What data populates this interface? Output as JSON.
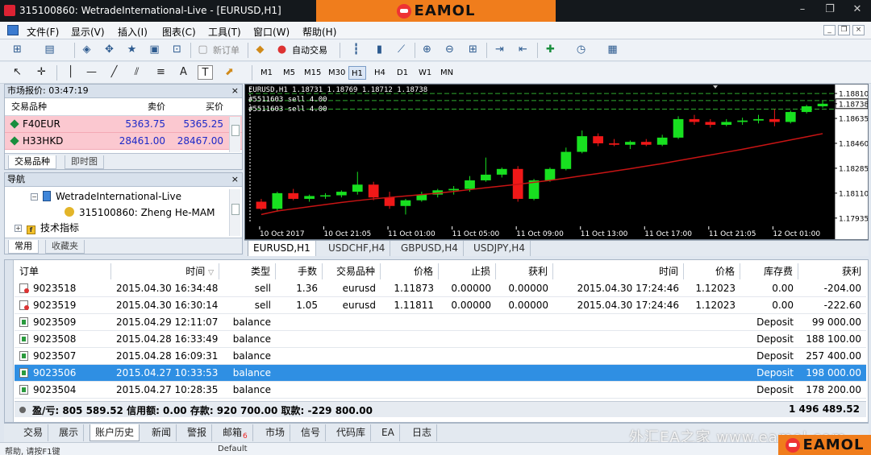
{
  "window": {
    "title": "315100860: WetradeInternational-Live - [EURUSD,H1]",
    "brand": "EAMOL",
    "controls": [
      "–",
      "❐",
      "✕"
    ]
  },
  "menu": {
    "items": [
      "文件(F)",
      "显示(V)",
      "插入(I)",
      "图表(C)",
      "工具(T)",
      "窗口(W)",
      "帮助(H)"
    ],
    "mdi_controls": [
      "_",
      "❐",
      "×"
    ]
  },
  "toolbar": {
    "new_order": "新订单",
    "auto_trading": "自动交易",
    "timeframes": [
      "M1",
      "M5",
      "M15",
      "M30",
      "H1",
      "H4",
      "D1",
      "W1",
      "MN"
    ],
    "active_timeframe": "H1",
    "text_tool": "A",
    "label_tool": "T"
  },
  "market_watch": {
    "title": "市场报价: 03:47:19",
    "columns": [
      "交易品种",
      "卖价",
      "买价"
    ],
    "rows": [
      {
        "symbol": "F40EUR",
        "bid": "5363.75",
        "ask": "5365.25"
      },
      {
        "symbol": "H33HKD",
        "bid": "28461.00",
        "ask": "28467.00"
      }
    ],
    "tabs": [
      "交易品种",
      "即时图"
    ]
  },
  "navigator": {
    "title": "导航",
    "server": "WetradeInternational-Live",
    "account": "315100860: Zheng He-MAM",
    "indicators": "技术指标",
    "tabs": [
      "常用",
      "收藏夹"
    ]
  },
  "chart": {
    "info_line1": "EURUSD,H1  1.18731 1.18769 1.18712 1.18738",
    "info_line2": "#5511603 sell 4.00",
    "info_line3": "#5511603 sell 4.00",
    "price_labels": [
      "1.18810",
      "1.18738",
      "1.18635",
      "1.18460",
      "1.18285",
      "1.18110",
      "1.17935"
    ],
    "time_labels": [
      "10 Oct 2017",
      "10 Oct 21:05",
      "11 Oct 01:00",
      "11 Oct 05:00",
      "11 Oct 09:00",
      "11 Oct 13:00",
      "11 Oct 17:00",
      "11 Oct 21:05",
      "12 Oct 01:00"
    ],
    "colors": {
      "bull": "#18e020",
      "bear": "#f01818",
      "ma": "#c81414",
      "level": "#2faa2f"
    },
    "candles": [
      [
        1.1805,
        1.1807,
        1.1799,
        1.18
      ],
      [
        1.18,
        1.1812,
        1.1798,
        1.1811
      ],
      [
        1.1811,
        1.1814,
        1.1806,
        1.1807
      ],
      [
        1.1807,
        1.181,
        1.1805,
        1.1809
      ],
      [
        1.1809,
        1.1811,
        1.1807,
        1.18095
      ],
      [
        1.18095,
        1.1813,
        1.1808,
        1.1812
      ],
      [
        1.1812,
        1.1826,
        1.181,
        1.1817
      ],
      [
        1.1817,
        1.1819,
        1.1806,
        1.1808
      ],
      [
        1.1808,
        1.1812,
        1.18,
        1.1802
      ],
      [
        1.1802,
        1.1807,
        1.1796,
        1.1806
      ],
      [
        1.1806,
        1.1812,
        1.1805,
        1.181
      ],
      [
        1.181,
        1.1814,
        1.1808,
        1.1813
      ],
      [
        1.1813,
        1.1816,
        1.181,
        1.1814
      ],
      [
        1.1814,
        1.1823,
        1.1812,
        1.182
      ],
      [
        1.182,
        1.1836,
        1.1819,
        1.1824
      ],
      [
        1.1824,
        1.1829,
        1.1822,
        1.1828
      ],
      [
        1.1828,
        1.183,
        1.1805,
        1.1807
      ],
      [
        1.1807,
        1.1821,
        1.1806,
        1.182
      ],
      [
        1.182,
        1.1829,
        1.1819,
        1.1828
      ],
      [
        1.1828,
        1.1843,
        1.1827,
        1.184
      ],
      [
        1.184,
        1.1855,
        1.1839,
        1.1851
      ],
      [
        1.1851,
        1.1853,
        1.1844,
        1.1846
      ],
      [
        1.1846,
        1.1849,
        1.1844,
        1.1845
      ],
      [
        1.1845,
        1.1848,
        1.1842,
        1.1847
      ],
      [
        1.1847,
        1.1849,
        1.1844,
        1.1845
      ],
      [
        1.1845,
        1.1852,
        1.1844,
        1.185
      ],
      [
        1.185,
        1.1865,
        1.1849,
        1.1863
      ],
      [
        1.1863,
        1.1866,
        1.1859,
        1.1861
      ],
      [
        1.1861,
        1.1863,
        1.1857,
        1.1859
      ],
      [
        1.1859,
        1.1863,
        1.1858,
        1.1861
      ],
      [
        1.1861,
        1.1864,
        1.1859,
        1.1862
      ],
      [
        1.1862,
        1.1866,
        1.186,
        1.1863
      ],
      [
        1.1863,
        1.187,
        1.1858,
        1.1861
      ],
      [
        1.1861,
        1.1869,
        1.186,
        1.1868
      ],
      [
        1.1868,
        1.1873,
        1.1867,
        1.1872
      ],
      [
        1.1872,
        1.1876,
        1.1871,
        1.18738
      ]
    ],
    "ma": [
      1.1796,
      1.17985,
      1.18,
      1.18015,
      1.1803,
      1.18045,
      1.18058,
      1.1807,
      1.1808,
      1.1809,
      1.181,
      1.1811,
      1.18122,
      1.18135,
      1.18148,
      1.1816,
      1.18172,
      1.18186,
      1.182,
      1.18215,
      1.18232,
      1.18248,
      1.18265,
      1.18282,
      1.183,
      1.18318,
      1.18338,
      1.18358,
      1.18378,
      1.18398,
      1.18418,
      1.1844,
      1.18462,
      1.18484,
      1.18506,
      1.18528
    ],
    "levels": [
      1.1881,
      1.1876,
      1.187
    ],
    "ylim": [
      1.179,
      1.1885
    ],
    "tabs": [
      "EURUSD,H1",
      "USDCHF,H4",
      "GBPUSD,H4",
      "USDJPY,H4"
    ]
  },
  "terminal": {
    "headers": [
      "订单",
      "时间",
      "类型",
      "手数",
      "交易品种",
      "价格",
      "止损",
      "获利",
      "时间",
      "价格",
      "库存费",
      "获利"
    ],
    "sort_indicator": "▽",
    "rows": [
      {
        "order": "9023518",
        "time": "2015.04.30 16:34:48",
        "type": "sell",
        "lots": "1.36",
        "symbol": "eurusd",
        "price": "1.11873",
        "sl": "0.00000",
        "tp": "0.00000",
        "close_time": "2015.04.30 17:24:46",
        "close_price": "1.12023",
        "swap": "0.00",
        "profit": "-204.00",
        "icon": "sell"
      },
      {
        "order": "9023519",
        "time": "2015.04.30 16:30:14",
        "type": "sell",
        "lots": "1.05",
        "symbol": "eurusd",
        "price": "1.11811",
        "sl": "0.00000",
        "tp": "0.00000",
        "close_time": "2015.04.30 17:24:46",
        "close_price": "1.12023",
        "swap": "0.00",
        "profit": "-222.60",
        "icon": "sell"
      },
      {
        "order": "9023509",
        "time": "2015.04.29 12:11:07",
        "type": "balance",
        "lots": "",
        "symbol": "",
        "price": "",
        "sl": "",
        "tp": "",
        "close_time": "",
        "close_price": "",
        "swap": "Deposit",
        "profit": "99 000.00",
        "icon": "balance"
      },
      {
        "order": "9023508",
        "time": "2015.04.28 16:33:49",
        "type": "balance",
        "lots": "",
        "symbol": "",
        "price": "",
        "sl": "",
        "tp": "",
        "close_time": "",
        "close_price": "",
        "swap": "Deposit",
        "profit": "188 100.00",
        "icon": "balance"
      },
      {
        "order": "9023507",
        "time": "2015.04.28 16:09:31",
        "type": "balance",
        "lots": "",
        "symbol": "",
        "price": "",
        "sl": "",
        "tp": "",
        "close_time": "",
        "close_price": "",
        "swap": "Deposit",
        "profit": "257 400.00",
        "icon": "balance"
      },
      {
        "order": "9023506",
        "time": "2015.04.27 10:33:53",
        "type": "balance",
        "lots": "",
        "symbol": "",
        "price": "",
        "sl": "",
        "tp": "",
        "close_time": "",
        "close_price": "",
        "swap": "Deposit",
        "profit": "198 000.00",
        "icon": "balance",
        "selected": true
      },
      {
        "order": "9023504",
        "time": "2015.04.27 10:28:35",
        "type": "balance",
        "lots": "",
        "symbol": "",
        "price": "",
        "sl": "",
        "tp": "",
        "close_time": "",
        "close_price": "",
        "swap": "Deposit",
        "profit": "178 200.00",
        "icon": "balance"
      }
    ],
    "summary": "盈/亏: 805 589.52  信用额: 0.00  存款: 920 700.00  取款: -229 800.00",
    "summary_total": "1 496 489.52"
  },
  "bottom_tabs": {
    "items": [
      "交易",
      "展示",
      "账户历史",
      "新闻",
      "警报",
      "邮箱",
      "市场",
      "信号",
      "代码库",
      "EA",
      "日志"
    ],
    "active": "账户历史",
    "mail_badge": "6"
  },
  "status": {
    "left": "帮助, 请按F1键",
    "profile": "Default"
  },
  "watermark": "外汇EA之家 www.eamol.com"
}
